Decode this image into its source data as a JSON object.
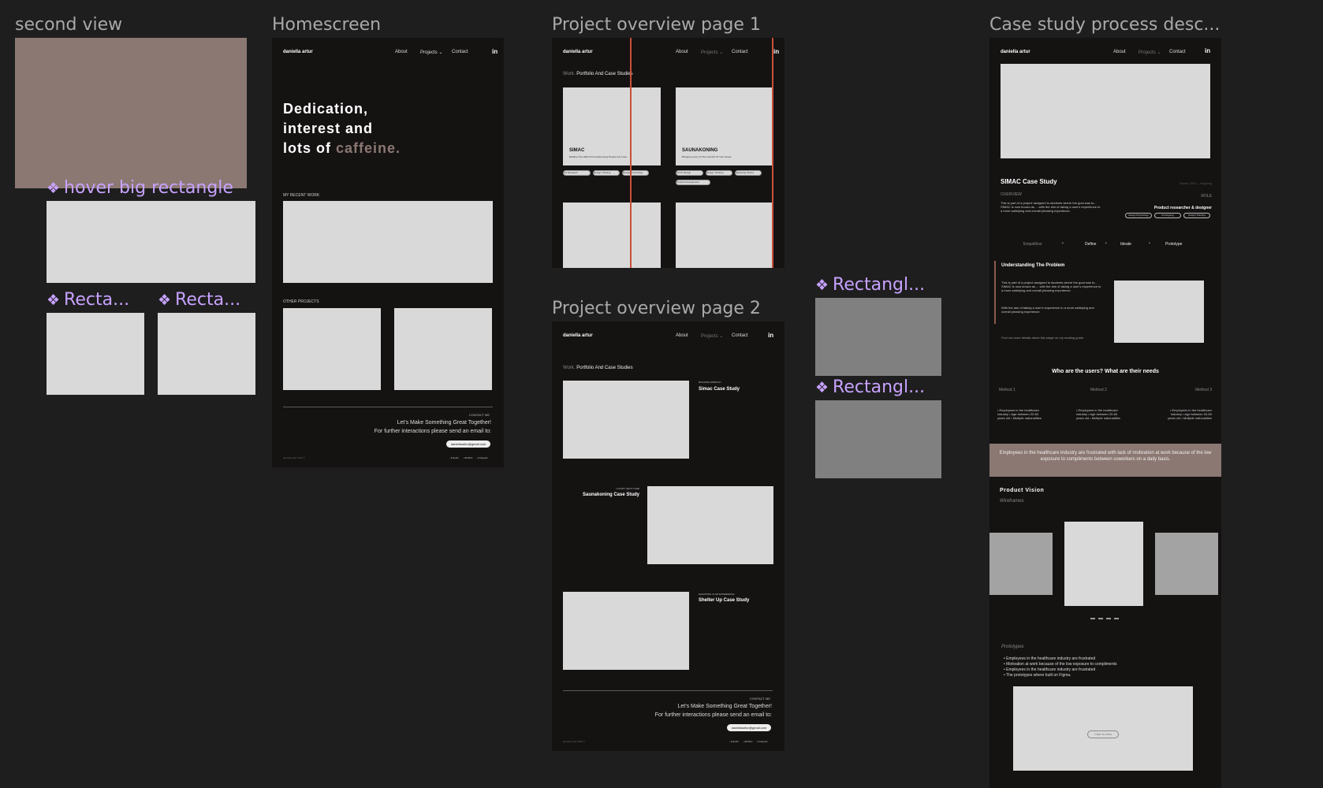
{
  "canvas": {
    "background": "#1e1e1e"
  },
  "frames": {
    "second_view": {
      "title": "second view"
    },
    "homescreen": {
      "title": "Homescreen"
    },
    "overview1": {
      "title": "Project overview page 1"
    },
    "overview2": {
      "title": "Project overview page 2"
    },
    "case_study": {
      "title": "Case study process desc..."
    }
  },
  "components": {
    "hover_big": "hover big rectangle",
    "recta_1": "Recta...",
    "recta_2": "Recta...",
    "rectangl_1": "Rectangl...",
    "rectangl_2": "Rectangl...",
    "icon": "component-diamond-icon"
  },
  "nav": {
    "brand": "daniella artur",
    "about": "About",
    "projects": "Projects ⌄",
    "contact": "Contact",
    "linkedin": "in"
  },
  "home": {
    "hero_line1": "Dedication,",
    "hero_line2": "interest and",
    "hero_line3": "lots of ",
    "hero_accent": "caffeine.",
    "recent_work": "MY RECENT WORK",
    "other_projects": "OTHER PROJECTS",
    "contact_me": "CONTACT ME",
    "footer_line1": "Let's Make Something Great Together!",
    "footer_line2": "For further interactions please send an email to:",
    "email_btn": "daniellaartur@gmail.com",
    "footer_left": "daniella artur 2023 ©",
    "socials": [
      "› linkedin",
      "› dribbble",
      "› instagram"
    ]
  },
  "ov1": {
    "work": "Work.",
    "heading": "Portfolio And Case Studies",
    "card1_title": "SIMAC",
    "card1_sub": "Building The Habit Of Complimenting People Into Lives",
    "card1_tags": [
      "UX Research",
      "Design Thinking",
      "Design Psychology"
    ],
    "card2_title": "SAUNAKONING",
    "card2_sub": "Bringing Luxury To The Comfort Of Your House",
    "card2_tags": [
      "UX/UI Design",
      "Design Thinking",
      "Marketing Tactics",
      "Product Development"
    ]
  },
  "ov2": {
    "work": "Work.",
    "heading": "Portfolio And Case Studies",
    "p1_tag": "BUILDING EMPATHY",
    "p1_title": "Simac Case Study",
    "p2_tag": "LUXURY SELF-CARE",
    "p2_title": "Saunakoning Case Study",
    "p3_tag": "ELEVATING CLUB EXPERIENCE",
    "p3_title": "Shelter Up Case Study",
    "contact_me": "CONTACT ME",
    "footer_line1": "Let's Make Something Great Together!",
    "footer_line2": "For further interactions please send an email to:",
    "email_btn": "daniellaartur@gmail.com",
    "footer_left": "daniella artur 2023 ©",
    "socials": [
      "› linkedin",
      "› dribbble",
      "› instagram"
    ]
  },
  "cs": {
    "title": "SIMAC Case Study",
    "date": "March 2023 – Ongoing",
    "overview_label": "OVERVIEW",
    "role_label": "ROLE",
    "overview_text": "This is part of a project assigned to students where the goal was to... SIMAC is now known as ... with the aim of taking a user's experience to a more satisfying and overall pleasing experience.",
    "role_text": "Product researcher & designer",
    "role_tags": [
      "Design Psychology",
      "Prototyping",
      "Design Thinking"
    ],
    "steps": [
      "Empathise",
      "Define",
      "Ideate",
      "Prototype"
    ],
    "problem_title": "Understanding The Problem",
    "problem_p1": "This is part of a project assigned to students where the goal was to... SIMAC is now known as ... with the aim of taking a user's experience to a more satisfying and overall pleasing experience.",
    "problem_p2": "With the aim of taking a user's experience to a more satisfying and overall pleasing experience.",
    "problem_link": "Find out more details about this stage on my reading guide.",
    "users_title": "Who are the users? What are their needs",
    "methods": [
      "Method 1",
      "Method 2",
      "Method 3"
    ],
    "method_text": "• Employees in the healthcare industry • Age between 20-60 years old • Multiple nationalities",
    "statement": "Employees in the healthcare industry are frustrated with lack of motivation at work because of the low exposure to compliments between coworkers on a daily basis.",
    "vision_title": "Product Vision",
    "wireframes": "Wireframes",
    "prototypes": "Prototypes",
    "proto_bullets": [
      "• Employees in the healthcare industry are frustrated",
      "• Motivation at work because of the low exposure to compliments",
      "• Employees in the healthcare industry are frustrated",
      "• The prototypes where built on Figma."
    ],
    "click_view": "Click to view"
  },
  "colors": {
    "frame_bg": "#151212",
    "accent": "#8b7872",
    "component_purple": "#c7a2ff",
    "red_guide": "#c8503a",
    "placeholder": "#d9d9d9"
  }
}
